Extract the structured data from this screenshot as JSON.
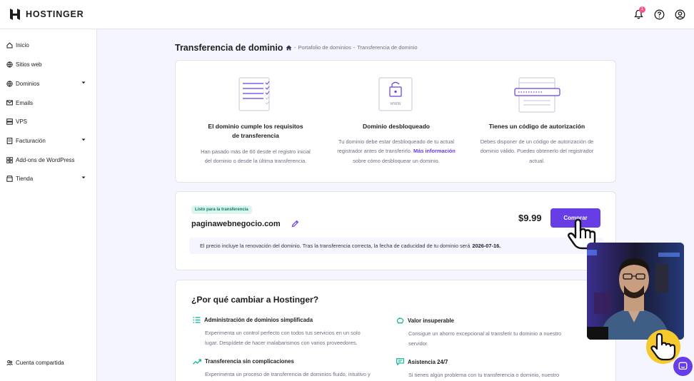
{
  "brand": {
    "name": "HOSTINGER",
    "accent": "#673de6"
  },
  "topbar": {
    "notification_count": "1",
    "icons": [
      "bell-icon",
      "help-icon",
      "account-icon"
    ]
  },
  "sidebar": {
    "items": [
      {
        "label": "Inicio",
        "icon": "home-icon"
      },
      {
        "label": "Sitios web",
        "icon": "globe-icon"
      },
      {
        "label": "Dominios",
        "icon": "globe-icon"
      },
      {
        "label": "Emails",
        "icon": "mail-icon"
      },
      {
        "label": "VPS",
        "icon": "server-icon"
      },
      {
        "label": "Facturación",
        "icon": "billing-icon"
      },
      {
        "label": "Add-ons de WordPress",
        "icon": "wordpress-icon"
      },
      {
        "label": "Tienda",
        "icon": "store-icon"
      }
    ],
    "shared_account": "Cuenta compartida"
  },
  "page": {
    "title": "Transferencia de dominio",
    "breadcrumb": [
      "Portafolio de dominios",
      "Transferencia de dominio"
    ]
  },
  "requirements": [
    {
      "title": "El dominio cumple los requisitos de transferencia",
      "text_lines": [
        "Han pasado más de 60 desde el registro inicial",
        "del dominio o desde la última transferencia."
      ]
    },
    {
      "title": "Dominio desbloqueado",
      "text_line1": "Tu dominio debe estar desbloqueado de tu actual",
      "text_line2_pre": "registrador antes de transferirlo.",
      "link": "Más información",
      "text_line3": "sobre cómo desbloquear un dominio.",
      "illustration_text": "www"
    },
    {
      "title": "Tienes un código de autorización",
      "text_lines": [
        "Debes disponer de un código de autorización de",
        "dominio válido. Puedes obtenerlo del registrador",
        "actual."
      ]
    }
  ],
  "transfer": {
    "badge": "Listo para la transferencia",
    "domain": "paginawebnegocio.com",
    "price": "$9.99",
    "buy_label": "Comprar",
    "notice_text": "El precio incluye la renovación del dominio. Tras la transferencia correcta, la fecha de caducidad de tu dominio será",
    "notice_date": "2026-07-16."
  },
  "why": {
    "title": "¿Por qué cambiar a Hostinger?",
    "features": [
      {
        "title": "Administración de dominios simplificada",
        "text_lines": [
          "Experimenta un control perfecto con todos tus servicios en un solo",
          "lugar. Despídete de hacer malabarismos con varios proveedores."
        ]
      },
      {
        "title": "Valor insuperable",
        "text_lines": [
          "Consigue un ahorro excepcional al transferir tu dominio a nuestro",
          "servidor."
        ]
      },
      {
        "title": "Transferencia sin complicaciones",
        "text_lines": [
          "Experimenta un proceso de transferencia de dominios fluido, intuitivo y"
        ]
      },
      {
        "title": "Asistencia 24/7",
        "text_lines": [
          "Si tienes algún problema con tu transferencia o dominio, nuestro"
        ]
      }
    ]
  }
}
